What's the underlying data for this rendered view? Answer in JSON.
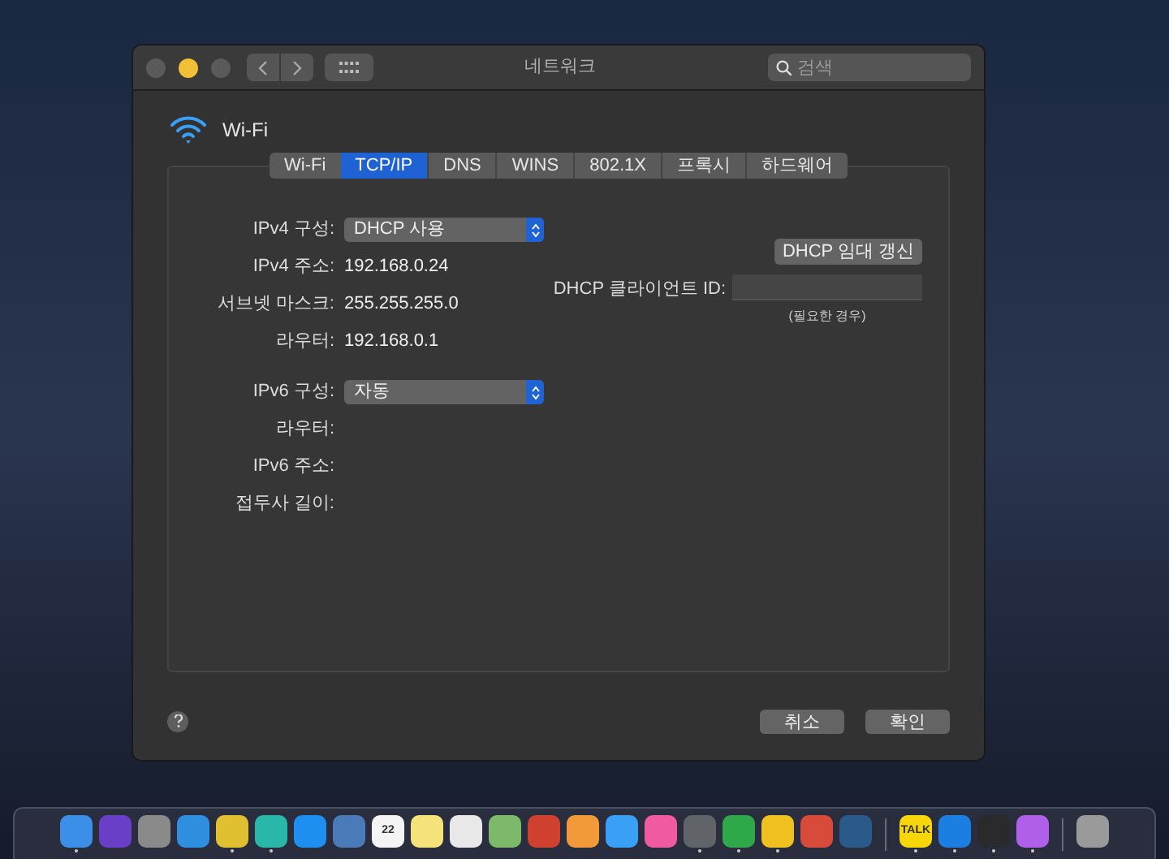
{
  "window": {
    "title": "네트워크",
    "search": {
      "placeholder": "검색"
    }
  },
  "interface": {
    "name": "Wi-Fi"
  },
  "tabs": [
    {
      "label": "Wi-Fi",
      "selected": false
    },
    {
      "label": "TCP/IP",
      "selected": true
    },
    {
      "label": "DNS",
      "selected": false
    },
    {
      "label": "WINS",
      "selected": false
    },
    {
      "label": "802.1X",
      "selected": false
    },
    {
      "label": "프록시",
      "selected": false
    },
    {
      "label": "하드웨어",
      "selected": false
    }
  ],
  "fields": [
    {
      "kind": "select",
      "label": "IPv4 구성:",
      "value": "DHCP 사용"
    },
    {
      "kind": "text",
      "label": "IPv4 주소:",
      "value": "192.168.0.24"
    },
    {
      "kind": "text",
      "label": "서브넷 마스크:",
      "value": "255.255.255.0"
    },
    {
      "kind": "text",
      "label": "라우터:",
      "value": "192.168.0.1"
    },
    {
      "kind": "select",
      "label": "IPv6 구성:",
      "value": "자동"
    },
    {
      "kind": "text",
      "label": "라우터:"
    },
    {
      "kind": "text",
      "label": "IPv6 주소:"
    },
    {
      "kind": "text",
      "label": "접두사 길이:"
    }
  ],
  "dhcp": {
    "renew_button": "DHCP 임대 갱신",
    "client_id_label": "DHCP 클라이언트 ID:",
    "client_id_hint": "(필요한 경우)"
  },
  "buttons": [
    "취소",
    "확인"
  ],
  "dock": [
    {
      "kind": "app",
      "color": "#3b8fe8",
      "running": true
    },
    {
      "kind": "app",
      "color": "#6a3fc8",
      "running": false
    },
    {
      "kind": "app",
      "color": "#8a8a8a",
      "running": false
    },
    {
      "kind": "app",
      "color": "#2f8ee0",
      "running": false
    },
    {
      "kind": "app",
      "color": "#e0c030",
      "running": true
    },
    {
      "kind": "app",
      "color": "#28b7a8",
      "running": true
    },
    {
      "kind": "app",
      "color": "#1e8ef0",
      "running": false
    },
    {
      "kind": "app",
      "color": "#4a7ab8",
      "running": false
    },
    {
      "kind": "app",
      "color": "#f4f4f4",
      "running": false,
      "label": "22"
    },
    {
      "kind": "app",
      "color": "#f5e27a",
      "running": false
    },
    {
      "kind": "app",
      "color": "#e8e8e8",
      "running": false
    },
    {
      "kind": "app",
      "color": "#7cb96a",
      "running": false
    },
    {
      "kind": "app",
      "color": "#d0402e",
      "running": false
    },
    {
      "kind": "app",
      "color": "#f29a3a",
      "running": false
    },
    {
      "kind": "app",
      "color": "#3aa0f5",
      "running": false
    },
    {
      "kind": "app",
      "color": "#f05aa0",
      "running": false
    },
    {
      "kind": "app",
      "color": "#606468",
      "running": true
    },
    {
      "kind": "app",
      "color": "#2fa84a",
      "running": true
    },
    {
      "kind": "app",
      "color": "#f0c020",
      "running": true
    },
    {
      "kind": "app",
      "color": "#d84a3a",
      "running": false
    },
    {
      "kind": "app",
      "color": "#2a5a8a",
      "running": false
    },
    {
      "kind": "separator"
    },
    {
      "kind": "app",
      "color": "#f7d70a",
      "running": true,
      "label": "TALK"
    },
    {
      "kind": "app",
      "color": "#1a7fe0",
      "running": true
    },
    {
      "kind": "app",
      "color": "#2a2a2c",
      "running": true
    },
    {
      "kind": "app",
      "color": "#b060e8",
      "running": true
    },
    {
      "kind": "separator"
    },
    {
      "kind": "app",
      "color": "#9a9a9a",
      "running": false
    }
  ]
}
